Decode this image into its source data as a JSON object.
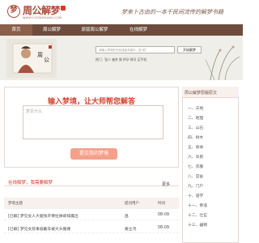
{
  "header": {
    "logo_mark": "梦",
    "logo_text": "周公解梦",
    "logo_sub": "WWW.CXGWEIKANG.COM",
    "slogan": "梦来卜古由的一本千民间流传的解梦书籍"
  },
  "nav": {
    "items": [
      "首页",
      "周公解梦",
      "原版周公解梦",
      "在线解梦"
    ]
  },
  "banner": {
    "search_placeholder": "请输入梦到的东西或者关键字，如“蛇”",
    "search_button": "开始解梦",
    "hot_text": "热门：坠人  被杀  屎  怀孕  掉牙  买手机"
  },
  "question": {
    "title": "输入梦境，让大师帮您解答",
    "placeholder": "梦见什么",
    "submit": "提交我的梦境"
  },
  "online": {
    "title": "在线解梦，我需要解梦",
    "more": "更多",
    "columns": [
      "梦境主题",
      "提问用户",
      "时间"
    ],
    "rows": [
      {
        "topic": "[已解] 梦见女人大腿张开要拉屎却排露出",
        "user": "昌",
        "time": "08-09"
      },
      {
        "topic": "[已解] 梦见女孩事鼓戴车被大头搬撞",
        "user": "秦立鸿",
        "time": "08-09"
      }
    ]
  },
  "sidebar": {
    "title": "周公解梦原版原文",
    "items": [
      "一、天地",
      "二、地理",
      "三、山石",
      "四、树木",
      "五、身体",
      "六、鸟兽",
      "七、衣服",
      "八、宫舍",
      "九、门户",
      "十、道学",
      "十一、佛道",
      "十二、仕宦",
      "十三、器物"
    ]
  }
}
